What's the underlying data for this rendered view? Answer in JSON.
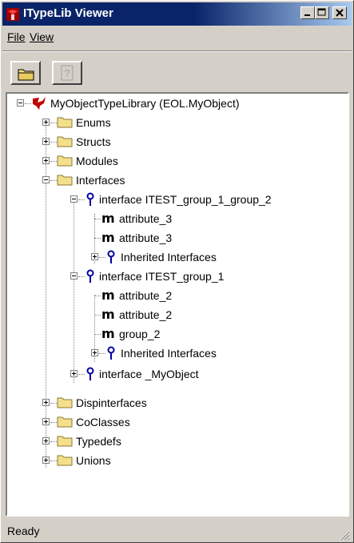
{
  "window": {
    "title": "ITypeLib Viewer",
    "controls": [
      "minimize",
      "maximize",
      "close"
    ]
  },
  "menu": {
    "items": [
      "File",
      "View"
    ]
  },
  "toolbar": {
    "buttons": [
      "open-folder",
      "help"
    ]
  },
  "tree": {
    "root": "MyObjectTypeLibrary (EOL.MyObject)",
    "nodes": {
      "enums": "Enums",
      "structs": "Structs",
      "modules": "Modules",
      "interfaces": "Interfaces",
      "iface1": "interface ITEST_group_1_group_2",
      "iface1_attr_a": "attribute_3",
      "iface1_attr_b": "attribute_3",
      "iface1_inherited": "Inherited Interfaces",
      "iface2": "interface ITEST_group_1",
      "iface2_attr_a": "attribute_2",
      "iface2_attr_b": "attribute_2",
      "iface2_group": "group_2",
      "iface2_inherited": "Inherited Interfaces",
      "iface3": "interface _MyObject",
      "dispinterfaces": "Dispinterfaces",
      "coclasses": "CoClasses",
      "typedefs": "Typedefs",
      "unions": "Unions"
    },
    "member_marker": "m"
  },
  "status": {
    "text": "Ready"
  },
  "colors": {
    "titlebar": "#0a246a",
    "titlebar_end": "#a6caf0",
    "face": "#d4d0c8",
    "folder": "#f4e08c",
    "pin": "#0000a0"
  }
}
